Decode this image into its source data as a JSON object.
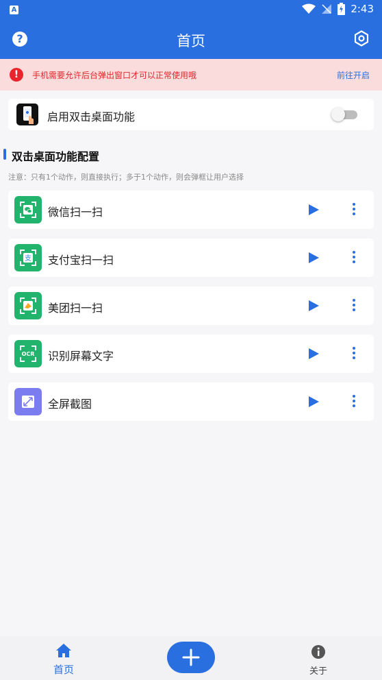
{
  "status_bar": {
    "time": "2:43",
    "app_indicator": "A"
  },
  "app_bar": {
    "title": "首页",
    "help_icon": "help-icon",
    "settings_icon": "settings-icon"
  },
  "banner": {
    "message": "手机需要允许后台弹出窗口才可以正常使用哦",
    "link": "前往开启",
    "color": "#e0262b"
  },
  "double_click": {
    "label": "启用双击桌面功能",
    "enabled": false
  },
  "section": {
    "title": "双击桌面功能配置",
    "note": "注意：只有1个动作，则直接执行；多于1个动作，则会弹框让用户选择"
  },
  "actions": [
    {
      "label": "微信扫一扫",
      "icon": "wechat-scan-icon"
    },
    {
      "label": "支付宝扫一扫",
      "icon": "alipay-scan-icon"
    },
    {
      "label": "美团扫一扫",
      "icon": "meituan-scan-icon"
    },
    {
      "label": "识别屏幕文字",
      "icon": "ocr-icon",
      "icon_text": "OCR"
    },
    {
      "label": "全屏截图",
      "icon": "fullscreen-screenshot-icon"
    }
  ],
  "bottom_nav": {
    "home": "首页",
    "about": "关于"
  },
  "colors": {
    "primary": "#2a6fe0",
    "accent_green": "#22b36d",
    "accent_purple": "#7b7cf0",
    "banner_bg": "#fbdcdc"
  }
}
